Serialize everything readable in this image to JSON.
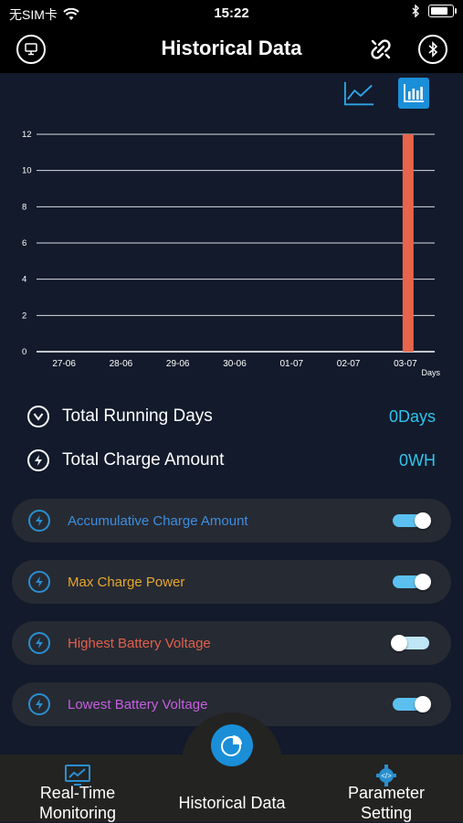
{
  "status": {
    "carrier": "无SIM卡",
    "time": "15:22",
    "battery_level": 0.8
  },
  "header": {
    "title": "Historical Data",
    "left_icon": "monitor-icon",
    "right_icons": [
      "link-icon",
      "bluetooth-icon"
    ]
  },
  "chart_switch": {
    "options": [
      "line-chart-icon",
      "bar-chart-icon"
    ],
    "selected": "bar-chart-icon"
  },
  "chart_data": {
    "type": "bar",
    "categories": [
      "27-06",
      "28-06",
      "29-06",
      "30-06",
      "01-07",
      "02-07",
      "03-07"
    ],
    "values": [
      0,
      0,
      0,
      0,
      0,
      0,
      12
    ],
    "xlabel": "Days",
    "ylabel": "",
    "ylim": [
      0,
      12
    ],
    "yticks": [
      "0",
      "2",
      "4",
      "6",
      "8",
      "10",
      "12"
    ],
    "grid": true,
    "bar_color": "#e8644a"
  },
  "stats": {
    "running_days": {
      "label": "Total Running Days",
      "value": "0Days"
    },
    "charge_amount": {
      "label": "Total Charge Amount",
      "value": "0WH"
    }
  },
  "toggles": [
    {
      "label": "Accumulative Charge Amount",
      "color": "#3d8fe0",
      "on": true
    },
    {
      "label": "Max Charge Power",
      "color": "#e6a72a",
      "on": true
    },
    {
      "label": "Highest Battery Voltage",
      "color": "#e0604c",
      "on": false
    },
    {
      "label": "Lowest Battery Voltage",
      "color": "#c75fe0",
      "on": true
    }
  ],
  "tabs": {
    "realtime": "Real-Time\nMonitoring",
    "historical": "Historical Data",
    "settings": "Parameter\nSetting"
  },
  "colors": {
    "accent": "#2fc4ec",
    "switch_on": "#5bc0f0",
    "switch_off": "#bfe6f7"
  }
}
